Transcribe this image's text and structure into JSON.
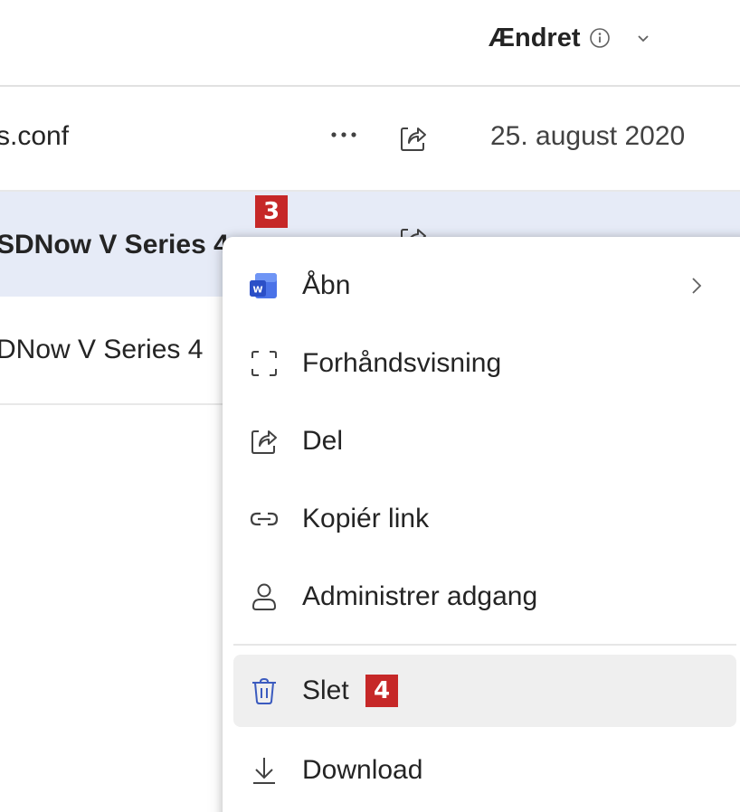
{
  "header": {
    "modified_label": "Ændret"
  },
  "rows": [
    {
      "name": "s.conf",
      "date": "25. august 2020"
    },
    {
      "name": "SDNow V Series 4",
      "date": ""
    },
    {
      "name": "DNow V Series 4",
      "date": ""
    }
  ],
  "badges": {
    "step3": "3",
    "step4": "4"
  },
  "menu": {
    "items": [
      {
        "label": "Åbn",
        "icon": "word-icon",
        "has_submenu": true
      },
      {
        "label": "Forhåndsvisning",
        "icon": "preview-icon"
      },
      {
        "label": "Del",
        "icon": "share-icon"
      },
      {
        "label": "Kopiér link",
        "icon": "link-icon"
      },
      {
        "label": "Administrer adgang",
        "icon": "person-icon"
      },
      {
        "label": "Slet",
        "icon": "trash-icon",
        "highlighted": true
      },
      {
        "label": "Download",
        "icon": "download-icon"
      }
    ]
  },
  "colors": {
    "selected_row": "#e6ebf7",
    "badge": "#c62828",
    "word_brand": "#3b5cd6",
    "delete_icon": "#3b5bbf"
  }
}
